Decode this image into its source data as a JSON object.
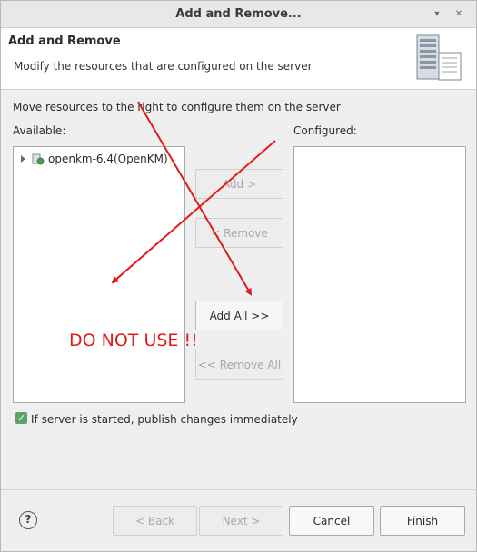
{
  "window": {
    "title": "Add and Remove..."
  },
  "header": {
    "title": "Add and Remove",
    "description": "Modify the resources that are configured on the server",
    "icon": "server-icon"
  },
  "instructions": "Move resources to the right to configure them on the server",
  "available": {
    "label": "Available:",
    "items": [
      {
        "label": "openkm-6.4(OpenKM)",
        "icon": "web-module-icon",
        "expanded": false
      }
    ]
  },
  "configured": {
    "label": "Configured:",
    "items": []
  },
  "buttons": {
    "add": "Add >",
    "remove": "< Remove",
    "add_all": "Add All >>",
    "remove_all": "<< Remove All"
  },
  "publish_checkbox": {
    "label": "If server is started, publish changes immediately",
    "checked": true
  },
  "footer": {
    "back": "< Back",
    "next": "Next >",
    "cancel": "Cancel",
    "finish": "Finish",
    "help_icon": "help-icon"
  },
  "annotation": {
    "text": "DO NOT USE !!",
    "color": "#e11b1b"
  }
}
